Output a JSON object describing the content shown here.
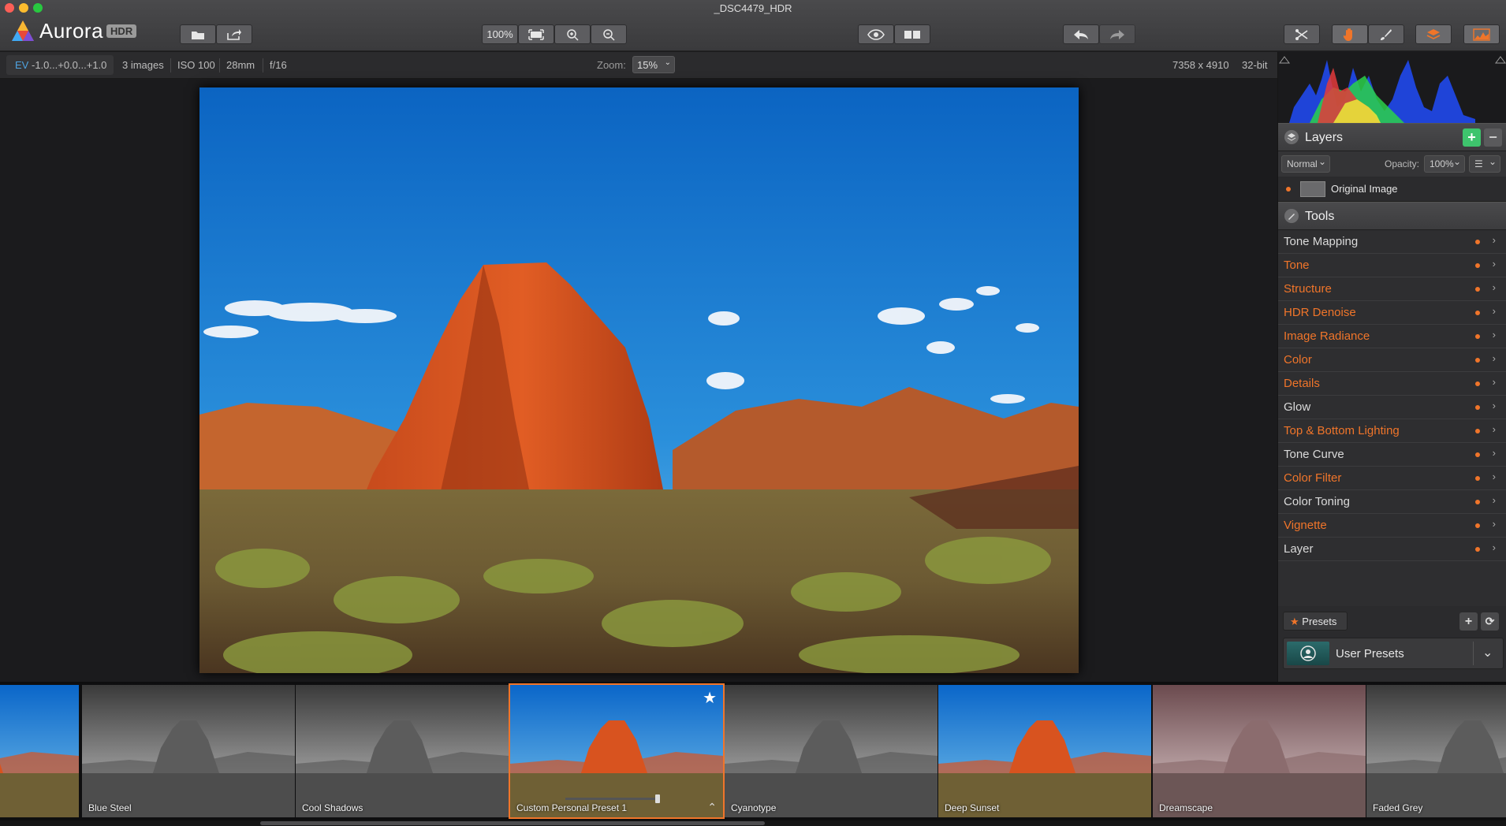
{
  "window": {
    "title": "_DSC4479_HDR"
  },
  "app": {
    "name": "Aurora",
    "badge": "HDR"
  },
  "toolbar": {
    "open_icon": "folder-icon",
    "share_icon": "share-icon",
    "zoom_100_label": "100%",
    "fit_icon": "fit-screen-icon",
    "zoom_in_icon": "zoom-in-icon",
    "zoom_out_icon": "zoom-out-icon",
    "preview_icon": "eye-icon",
    "compare_icon": "compare-icon",
    "undo_icon": "undo-icon",
    "redo_icon": "redo-icon",
    "crop_icon": "crop-icon",
    "hand_icon": "hand-icon",
    "brush_icon": "brush-icon",
    "layers_icon": "layers-icon",
    "histogram_icon": "histogram-icon",
    "accent": "#f0752a"
  },
  "info": {
    "ev_label": "EV",
    "ev_values": "-1.0...+0.0...+1.0",
    "images": "3 images",
    "iso": "ISO 100",
    "focal": "28mm",
    "aperture": "f/16",
    "zoom_label": "Zoom:",
    "zoom_value": "15%",
    "dimensions": "7358 x 4910",
    "bitdepth": "32-bit"
  },
  "layers": {
    "title": "Layers",
    "blend_mode": "Normal",
    "opacity_label": "Opacity:",
    "opacity_value": "100%",
    "items": [
      {
        "name": "Original Image"
      }
    ]
  },
  "tools": {
    "title": "Tools",
    "items": [
      {
        "label": "Tone Mapping",
        "active": false
      },
      {
        "label": "Tone",
        "active": true
      },
      {
        "label": "Structure",
        "active": true
      },
      {
        "label": "HDR Denoise",
        "active": true
      },
      {
        "label": "Image Radiance",
        "active": true
      },
      {
        "label": "Color",
        "active": true
      },
      {
        "label": "Details",
        "active": true
      },
      {
        "label": "Glow",
        "active": false
      },
      {
        "label": "Top & Bottom Lighting",
        "active": true
      },
      {
        "label": "Tone Curve",
        "active": false
      },
      {
        "label": "Color Filter",
        "active": true
      },
      {
        "label": "Color Toning",
        "active": false
      },
      {
        "label": "Vignette",
        "active": true
      },
      {
        "label": "Layer",
        "active": false
      }
    ]
  },
  "presets": {
    "tab_label": "Presets",
    "category": "User Presets",
    "items": [
      {
        "label": "",
        "style": "color"
      },
      {
        "label": "Blue Steel",
        "style": "gray"
      },
      {
        "label": "Cool Shadows",
        "style": "gray"
      },
      {
        "label": "Custom Personal Preset 1",
        "style": "color",
        "selected": true,
        "favorite": true
      },
      {
        "label": "Cyanotype",
        "style": "gray"
      },
      {
        "label": "Deep Sunset",
        "style": "color"
      },
      {
        "label": "Dreamscape",
        "style": "pink"
      },
      {
        "label": "Faded Grey",
        "style": "gray"
      }
    ]
  },
  "colors": {
    "active_tool": "#f0752a",
    "inactive_tool": "#dadada",
    "panel_bg": "#2e2e30"
  }
}
